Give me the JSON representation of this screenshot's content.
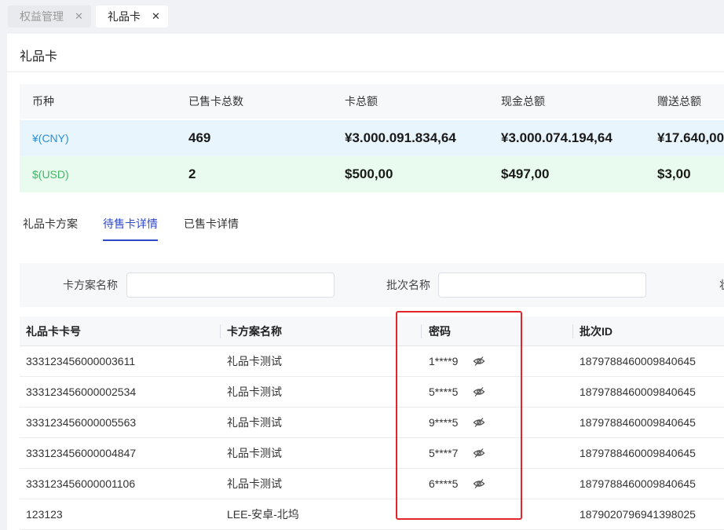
{
  "tabs": [
    {
      "label": "权益管理",
      "active": false
    },
    {
      "label": "礼品卡",
      "active": true
    }
  ],
  "close_glyph": "✕",
  "page": {
    "title": "礼品卡"
  },
  "summary": {
    "headers": [
      "币种",
      "已售卡总数",
      "卡总额",
      "现金总额",
      "赠送总额"
    ],
    "rows": [
      {
        "currency": "¥(CNY)",
        "sold": "469",
        "card_total": "¥3.000.091.834,64",
        "cash_total": "¥3.000.074.194,64",
        "gift_total": "¥17.640,00"
      },
      {
        "currency": "$(USD)",
        "sold": "2",
        "card_total": "$500,00",
        "cash_total": "$497,00",
        "gift_total": "$3,00"
      }
    ],
    "colors": {
      "cny_bg": "#e8f5fd",
      "cny_text": "#2a8fd6",
      "usd_bg": "#e9fbee",
      "usd_text": "#3fb764"
    }
  },
  "subtabs": [
    {
      "label": "礼品卡方案",
      "active": false
    },
    {
      "label": "待售卡详情",
      "active": true
    },
    {
      "label": "已售卡详情",
      "active": false
    }
  ],
  "accent": "#2f49c9",
  "filters": {
    "plan_label": "卡方案名称",
    "plan_value": "",
    "batch_label": "批次名称",
    "batch_value": "",
    "third_label_partial": "状"
  },
  "table": {
    "headers": [
      "礼品卡卡号",
      "卡方案名称",
      "密码",
      "批次ID"
    ],
    "rows": [
      {
        "card_no": "333123456000003611",
        "plan": "礼品卡测试",
        "password": "1****9",
        "batch_id": "1879788460009840645"
      },
      {
        "card_no": "333123456000002534",
        "plan": "礼品卡测试",
        "password": "5****5",
        "batch_id": "1879788460009840645"
      },
      {
        "card_no": "333123456000005563",
        "plan": "礼品卡测试",
        "password": "9****5",
        "batch_id": "1879788460009840645"
      },
      {
        "card_no": "333123456000004847",
        "plan": "礼品卡测试",
        "password": "5****7",
        "batch_id": "1879788460009840645"
      },
      {
        "card_no": "333123456000001106",
        "plan": "礼品卡测试",
        "password": "6****5",
        "batch_id": "1879788460009840645"
      },
      {
        "card_no": "123123",
        "plan": "LEE-安卓-北坞",
        "password": "",
        "batch_id": "1879020796941398025"
      }
    ],
    "password_toggle_icon": "eye-off-icon"
  },
  "highlight_color": "#e5242b"
}
